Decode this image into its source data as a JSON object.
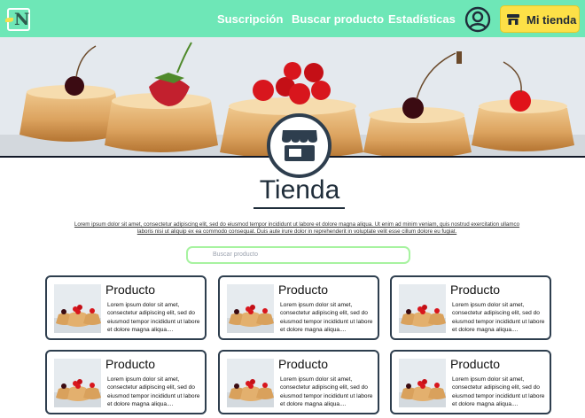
{
  "header": {
    "logo_letter": "N",
    "nav": [
      "Suscripción",
      "Buscar producto",
      "Estadísticas"
    ],
    "store_button_label": "Mi tienda"
  },
  "store": {
    "title": "Tienda",
    "description": "Lorem ipsum dolor sit amet, consectetur adipiscing elit, sed do eiusmod tempor incididunt ut labore et dolore magna aliqua. Ut enim ad minim veniam, quis nostrud exercitation ullamco laboris nisi ut aliquip ex ea commodo consequat. Duis aute irure dolor in reprehenderit in voluptate velit esse cillum dolore eu fugiat."
  },
  "search": {
    "placeholder": "Buscar producto"
  },
  "products": [
    {
      "title": "Producto",
      "description": "Lorem ipsum dolor sit amet, consectetur adipiscing elit, sed do eiusmod tempor incididunt ut labore et dolore magna aliqua...."
    },
    {
      "title": "Producto",
      "description": "Lorem ipsum dolor sit amet, consectetur adipiscing elit, sed do eiusmod tempor incididunt ut labore et dolore magna aliqua...."
    },
    {
      "title": "Producto",
      "description": "Lorem ipsum dolor sit amet, consectetur adipiscing elit, sed do eiusmod tempor incididunt ut labore et dolore magna aliqua...."
    },
    {
      "title": "Producto",
      "description": "Lorem ipsum dolor sit amet, consectetur adipiscing elit, sed do eiusmod tempor incididunt ut labore et dolore magna aliqua...."
    },
    {
      "title": "Producto",
      "description": "Lorem ipsum dolor sit amet, consectetur adipiscing elit, sed do eiusmod tempor incididunt ut labore et dolore magna aliqua...."
    },
    {
      "title": "Producto",
      "description": "Lorem ipsum dolor sit amet, consectetur adipiscing elit, sed do eiusmod tempor incididunt ut labore et dolore magna aliqua...."
    }
  ],
  "colors": {
    "header_bg": "#6ee7b7",
    "store_button_bg": "#fde047",
    "card_border": "#2e3e4e",
    "search_border": "#a7f3a0"
  },
  "icons": {
    "logo": "logo-icon",
    "user": "user-circle-icon",
    "store": "store-icon",
    "product_image": "cake-image"
  }
}
